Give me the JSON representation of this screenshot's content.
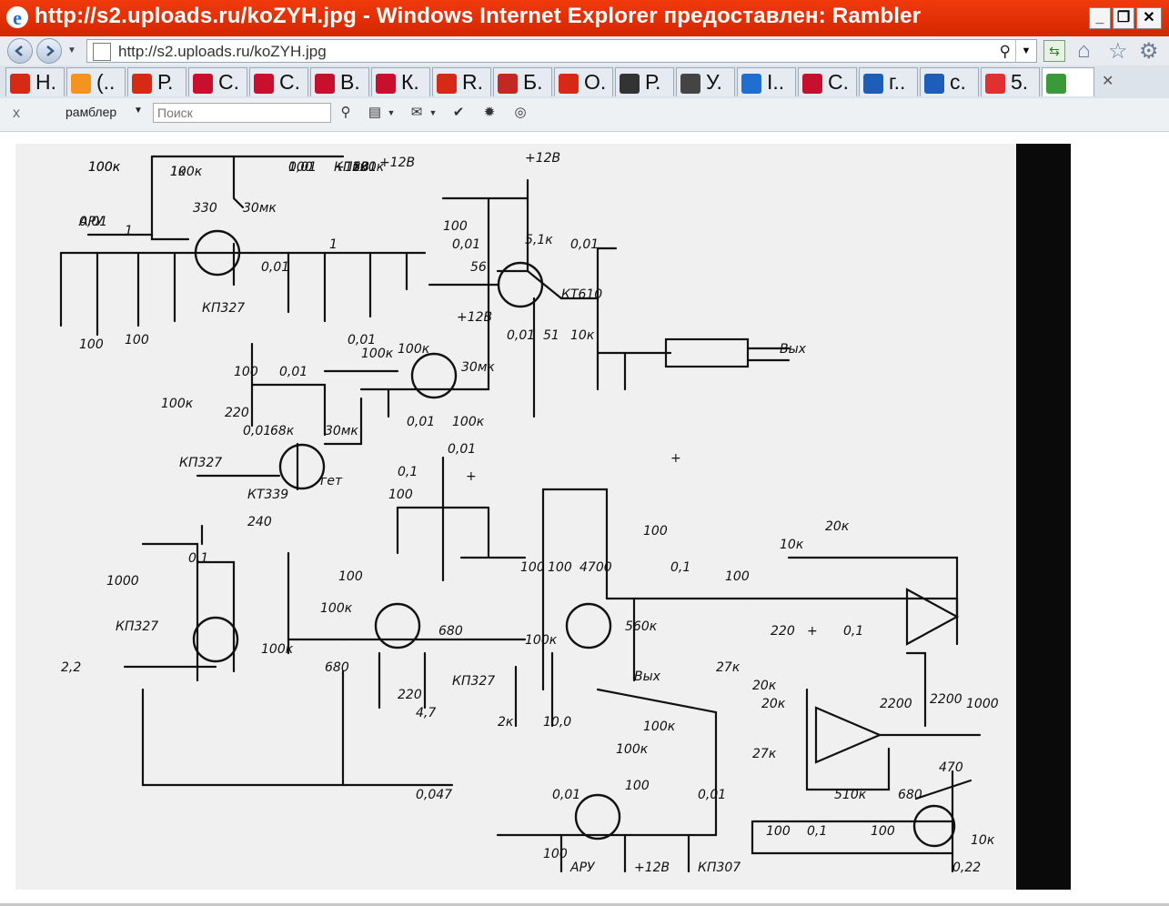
{
  "window": {
    "title": "http://s2.uploads.ru/koZYH.jpg - Windows Internet Explorer предоставлен: Rambler",
    "controls": [
      "minimize",
      "maximize",
      "close"
    ]
  },
  "address_bar": {
    "url": "http://s2.uploads.ru/koZYH.jpg",
    "search_glyph": "⚲"
  },
  "tabs": [
    {
      "label": "Н.",
      "icon": "rambler-icon",
      "color": "#d62a16"
    },
    {
      "label": "(..",
      "icon": "odnoklassniki-icon",
      "color": "#f4931e"
    },
    {
      "label": "Р.",
      "icon": "rambler-icon",
      "color": "#d62a16"
    },
    {
      "label": "С.",
      "icon": "sprashivai-icon",
      "color": "#c8102e"
    },
    {
      "label": "С.",
      "icon": "sprashivai-icon",
      "color": "#c8102e"
    },
    {
      "label": "В.",
      "icon": "sprashivai-icon",
      "color": "#c8102e"
    },
    {
      "label": "К.",
      "icon": "site-icon",
      "color": "#c8102e"
    },
    {
      "label": "R.",
      "icon": "rambler-icon",
      "color": "#d62a16"
    },
    {
      "label": "Б.",
      "icon": "emblem-icon",
      "color": "#c02a20"
    },
    {
      "label": "О.",
      "icon": "rambler-icon",
      "color": "#d62a16"
    },
    {
      "label": "Р.",
      "icon": "film-reel-icon",
      "color": "#333333"
    },
    {
      "label": "У.",
      "icon": "wikipedia-icon",
      "color": "#444444"
    },
    {
      "label": "I..",
      "icon": "ie-icon",
      "color": "#1e6fd0"
    },
    {
      "label": "С.",
      "icon": "sprashivai-icon",
      "color": "#c8102e"
    },
    {
      "label": "г..",
      "icon": "ef-icon",
      "color": "#1d5fb8"
    },
    {
      "label": "с.",
      "icon": "ef-icon",
      "color": "#1d5fb8"
    },
    {
      "label": "5.",
      "icon": "yandex-icon",
      "color": "#e03030"
    },
    {
      "label": "",
      "icon": "image-tab-icon",
      "color": "#3a9a3a"
    }
  ],
  "tab_close_glyph": "✕",
  "command_bar": {
    "close_glyph": "x",
    "brand": "рамблер",
    "search_placeholder": "Поиск"
  },
  "image": {
    "description": "Hand-drawn radio schematic scan",
    "labels": [
      "100к",
      "100к",
      "0,01",
      "+12В",
      "0,01",
      "100к",
      "+12В",
      "1",
      "330",
      "30мк",
      "0,01",
      "1",
      "100",
      "100",
      "КП327",
      "0,01",
      "56",
      "100",
      "КТ610",
      "0,01",
      "+12В",
      "0,01",
      "100к",
      "100к",
      "+12В",
      "5,1к",
      "0,01",
      "51",
      "10к",
      "Вых",
      "100",
      "0,01",
      "100к",
      "220",
      "30мк",
      "0,01",
      "68к",
      "30мк",
      "0,01",
      "100к",
      "КП327",
      "гет",
      "КТ339",
      "0,01",
      "+",
      "100",
      "0,1",
      "+",
      "100",
      "0,1",
      "100",
      "4700",
      "0,1",
      "560к",
      "240",
      "1000",
      "КП327",
      "100",
      "100к",
      "680",
      "100к",
      "680",
      "КП327",
      "220",
      "100",
      "100к",
      "100",
      "220",
      "+",
      "0,1",
      "10к",
      "20к",
      "20к",
      "20к",
      "2200",
      "2200",
      "1000",
      "27к",
      "27к",
      "2к",
      "10,0",
      "Вых",
      "4,7",
      "0,047",
      "100к",
      "100к",
      "0,01",
      "100",
      "0,01",
      "100",
      "АРУ",
      "+12В",
      "КП307",
      "100",
      "0,1",
      "100",
      "510к",
      "470",
      "680",
      "10к",
      "0,22",
      "2,2",
      "100к",
      "1к",
      "АРУ",
      "КП501",
      "100",
      "вх"
    ]
  }
}
